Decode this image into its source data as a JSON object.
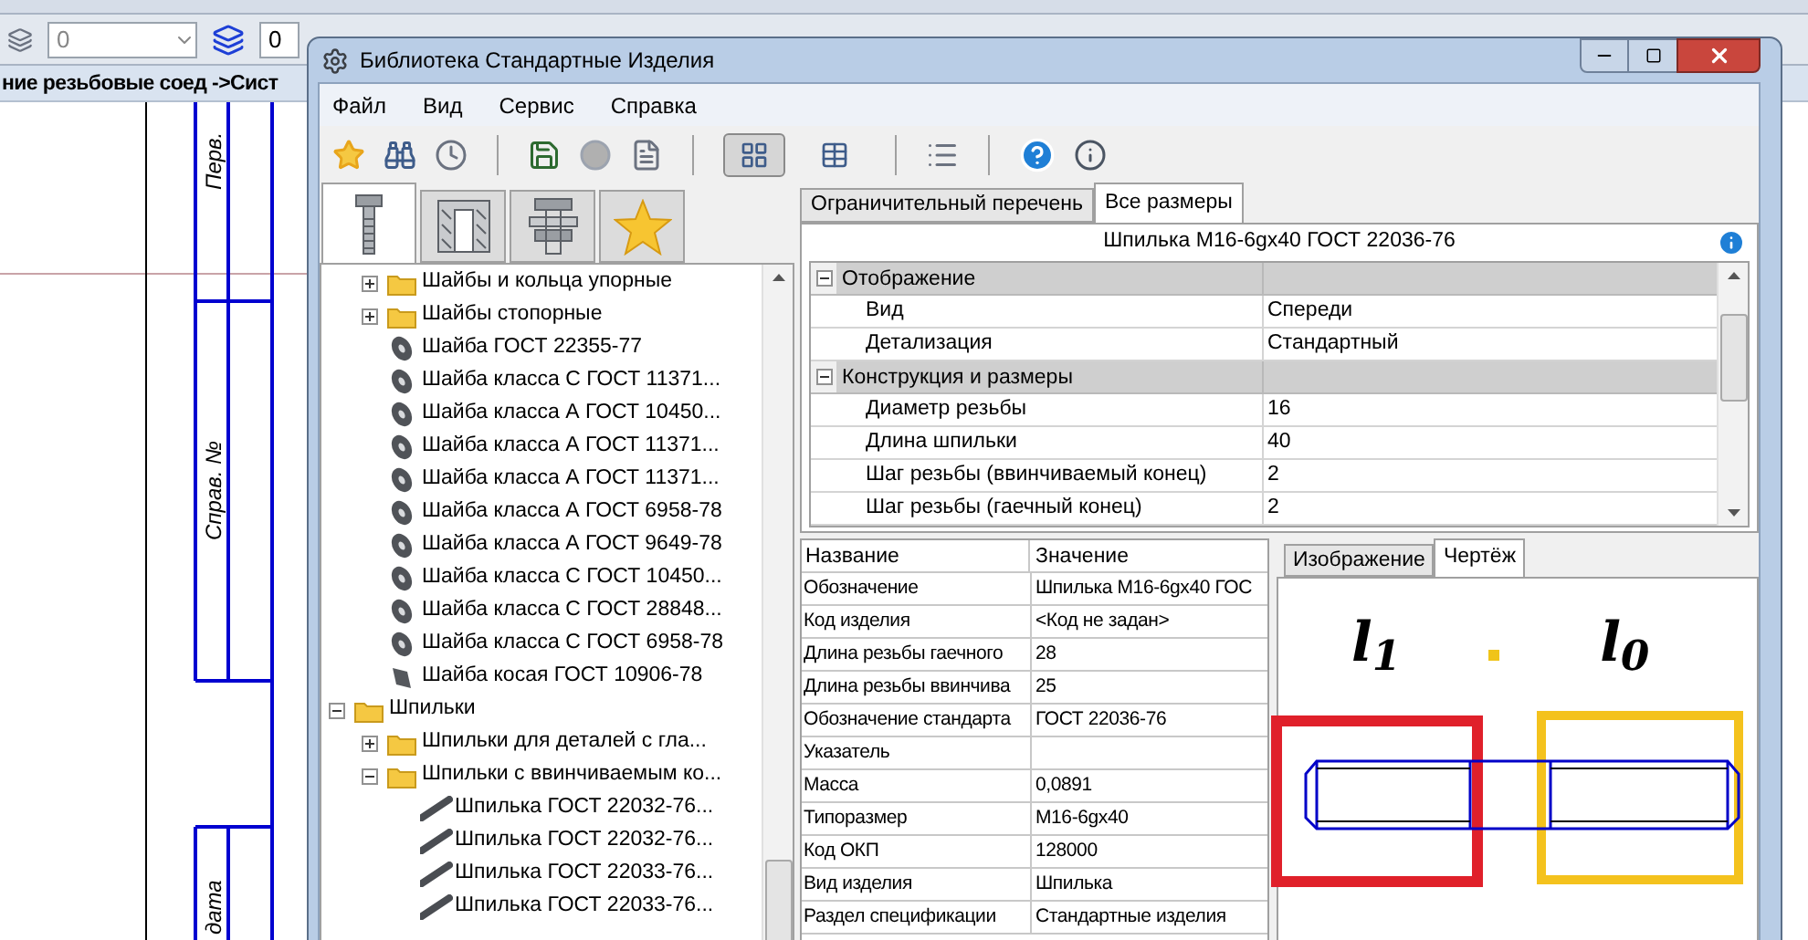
{
  "background": {
    "toolbar_fields": [
      {
        "value": "0"
      },
      {
        "value": "0"
      }
    ],
    "document_title": "ние резьбовые соед ->Сист",
    "stamp_labels": [
      "Перв.",
      "Справ. №",
      "дата"
    ]
  },
  "window": {
    "title": "Библиотека Стандартные Изделия"
  },
  "menu": [
    "Файл",
    "Вид",
    "Сервис",
    "Справка"
  ],
  "toolbar": {
    "view_toggles": [
      {
        "selected": true
      },
      {
        "selected": false
      }
    ]
  },
  "category_tabs": [
    {
      "kind": "bolt",
      "selected": true
    },
    {
      "kind": "hole",
      "selected": false
    },
    {
      "kind": "assembly",
      "selected": false
    },
    {
      "kind": "favorites",
      "selected": false
    }
  ],
  "tree": [
    {
      "children": [
        {
          "label": "Шайбы и кольца упорные",
          "kind": "folder",
          "expanded": false
        },
        {
          "label": "Шайбы стопорные",
          "kind": "folder",
          "expanded": false
        },
        {
          "label": "Шайба ГОСТ 22355-77",
          "kind": "washer"
        },
        {
          "label": "Шайба класса С ГОСТ 11371...",
          "kind": "washer"
        },
        {
          "label": "Шайба класса А ГОСТ 10450...",
          "kind": "washer"
        },
        {
          "label": "Шайба класса А ГОСТ 11371...",
          "kind": "washer"
        },
        {
          "label": "Шайба класса А ГОСТ 11371...",
          "kind": "washer"
        },
        {
          "label": "Шайба класса А ГОСТ 6958-78",
          "kind": "washer"
        },
        {
          "label": "Шайба класса А ГОСТ 9649-78",
          "kind": "washer"
        },
        {
          "label": "Шайба класса С ГОСТ 10450...",
          "kind": "washer"
        },
        {
          "label": "Шайба класса С ГОСТ 28848...",
          "kind": "washer"
        },
        {
          "label": "Шайба класса С ГОСТ 6958-78",
          "kind": "washer"
        },
        {
          "label": "Шайба косая ГОСТ 10906-78",
          "kind": "slanted-washer"
        }
      ]
    },
    {
      "label": "Шпильки",
      "kind": "folder",
      "expanded": true,
      "children": [
        {
          "label": "Шпильки для деталей с гла...",
          "kind": "folder",
          "expanded": false
        },
        {
          "label": "Шпильки с ввинчиваемым ко...",
          "kind": "folder",
          "expanded": true,
          "children": [
            {
              "label": "Шпилька ГОСТ 22032-76...",
              "kind": "stud"
            },
            {
              "label": "Шпилька ГОСТ 22032-76...",
              "kind": "stud"
            },
            {
              "label": "Шпилька ГОСТ 22033-76...",
              "kind": "stud"
            },
            {
              "label": "Шпилька ГОСТ 22033-76...",
              "kind": "stud"
            }
          ]
        }
      ]
    }
  ],
  "tabs": [
    {
      "label": "Ограничительный перечень",
      "selected": false
    },
    {
      "label": "Все размеры",
      "selected": true
    }
  ],
  "item_title": "Шпилька М16-6gх40 ГОСТ 22036-76",
  "property_groups": [
    {
      "label": "Отображение",
      "expanded": true,
      "rows": [
        {
          "name": "Вид",
          "value": "Спереди"
        },
        {
          "name": "Детализация",
          "value": "Стандартный"
        }
      ]
    },
    {
      "label": "Конструкция и размеры",
      "expanded": true,
      "rows": [
        {
          "name": "Диаметр резьбы",
          "value": "16"
        },
        {
          "name": "Длина шпильки",
          "value": "40"
        },
        {
          "name": "Шаг резьбы (ввинчиваемый конец)",
          "value": "2"
        },
        {
          "name": "Шаг резьбы (гаечный конец)",
          "value": "2"
        }
      ]
    }
  ],
  "attributes": {
    "columns": [
      "Название",
      "Значение"
    ],
    "rows": [
      {
        "name": "Обозначение",
        "value": "Шпилька М16-6gх40 ГОС"
      },
      {
        "name": "Код изделия",
        "value": "<Код не задан>"
      },
      {
        "name": "Длина резьбы гаечного",
        "value": "28"
      },
      {
        "name": "Длина резьбы ввинчива",
        "value": "25"
      },
      {
        "name": "Обозначение стандарта",
        "value": "ГОСТ 22036-76"
      },
      {
        "name": "Указатель",
        "value": ""
      },
      {
        "name": "Масса",
        "value": "0,0891"
      },
      {
        "name": "Типоразмер",
        "value": "М16-6gх40"
      },
      {
        "name": "Код ОКП",
        "value": "128000"
      },
      {
        "name": "Вид изделия",
        "value": "Шпилька"
      },
      {
        "name": "Раздел спецификации",
        "value": "Стандартные изделия"
      }
    ]
  },
  "preview": {
    "tabs": [
      {
        "label": "Изображение",
        "selected": false
      },
      {
        "label": "Чертёж",
        "selected": true
      }
    ],
    "labels": [
      "l$_{1}$",
      "l$_{0}$"
    ]
  }
}
